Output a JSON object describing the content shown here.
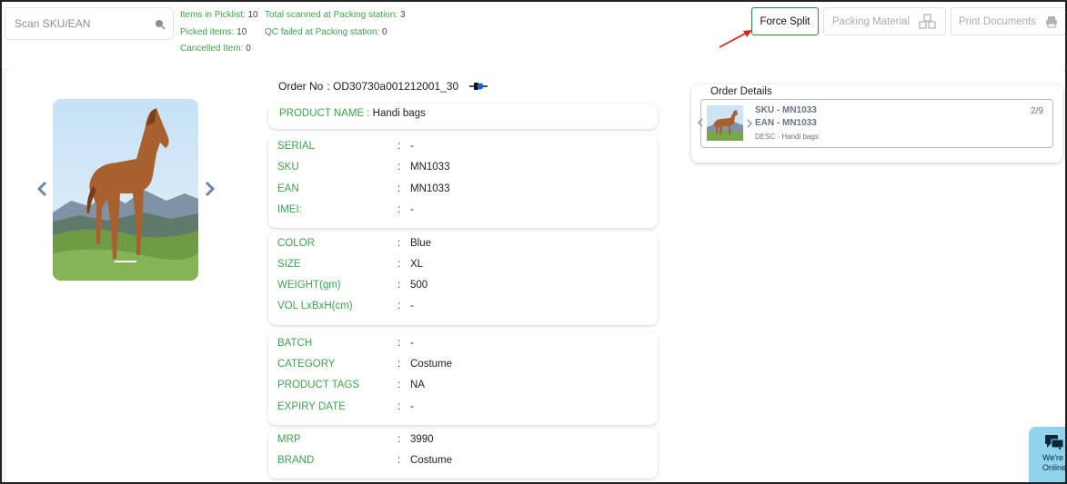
{
  "search": {
    "placeholder": "Scan SKU/EAN"
  },
  "stats": {
    "items_in_picklist_label": "Items in Picklist:",
    "items_in_picklist_value": "10",
    "total_scanned_label": "Total scanned at Packing station:",
    "total_scanned_value": "3",
    "picked_items_label": "Picked items:",
    "picked_items_value": "10",
    "qc_failed_label": "QC failed at Packing station:",
    "qc_failed_value": "0",
    "cancelled_label": "Cancelled Item:",
    "cancelled_value": "0"
  },
  "toolbar": {
    "force_split": "Force Split",
    "packing_material": "Packing Material",
    "print_documents": "Print Documents"
  },
  "order": {
    "label": "Order No",
    "value": ": OD30730a001212001_30"
  },
  "product": {
    "name_label": "PRODUCT NAME :",
    "name_value": "Handi bags",
    "card1": [
      {
        "label": "SERIAL",
        "value": "-"
      },
      {
        "label": "SKU",
        "value": "MN1033"
      },
      {
        "label": "EAN",
        "value": "MN1033"
      },
      {
        "label": "IMEI:",
        "value": "-"
      }
    ],
    "card2": [
      {
        "label": "COLOR",
        "value": "Blue"
      },
      {
        "label": "SIZE",
        "value": "XL"
      },
      {
        "label": "WEIGHT(gm)",
        "value": "500"
      },
      {
        "label": "VOL LxBxH(cm)",
        "value": "-"
      }
    ],
    "card3": [
      {
        "label": "BATCH",
        "value": "-"
      },
      {
        "label": "CATEGORY",
        "value": "Costume"
      },
      {
        "label": "PRODUCT TAGS",
        "value": "NA"
      },
      {
        "label": "EXPIRY DATE",
        "value": "-"
      }
    ],
    "card4": [
      {
        "label": "MRP",
        "value": "3990"
      },
      {
        "label": "BRAND",
        "value": "Costume"
      }
    ]
  },
  "order_details": {
    "title": "Order Details",
    "sku": "SKU - MN1033",
    "ean": "EAN - MN1033",
    "desc": "DESC - Handi bags",
    "count": "2/9"
  },
  "chat": {
    "line1": "We're",
    "line2": "Online!"
  },
  "colors": {
    "accent_green": "#3fa34d",
    "force_split_border": "#2e8b3e",
    "chat_bg": "#8fd3ec"
  },
  "icons": [
    "search-icon",
    "boxes-icon",
    "printer-icon",
    "plug-icon",
    "chevron-left-icon",
    "chevron-right-icon",
    "chat-icon",
    "arrow-annotation"
  ]
}
